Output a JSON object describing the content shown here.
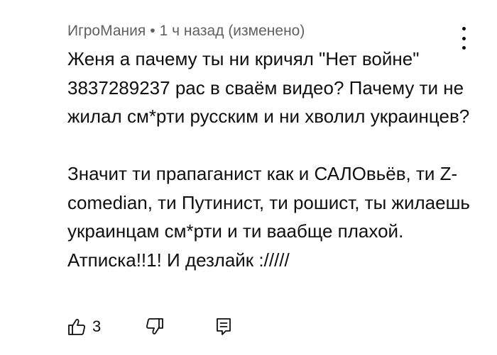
{
  "comment": {
    "author": "ИгроМания",
    "separator": "•",
    "time": "1 ч назад (изменено)",
    "paragraphs": [
      "Женя а пачему ты ни кричял \"Нет войне\" 3837289237 рас в сваём видео? Пачему ти не жилал см*рти русским и ни хволил украинцев?",
      "Значит ти прапаганист как и САЛОвьёв, ти Z-comedian, ти Путинист, ти рошист, ты жилаешь украинцам см*рти и ти ваабще плахой. Атписка!!1! И дезлайк ://///"
    ],
    "like_count": "3"
  },
  "icons": {
    "like": "thumbs-up-icon",
    "dislike": "thumbs-down-icon",
    "reply": "comment-reply-icon",
    "menu": "more-vertical-icon"
  },
  "colors": {
    "text": "#0f0f0f",
    "meta": "#606060",
    "background": "#ffffff"
  }
}
